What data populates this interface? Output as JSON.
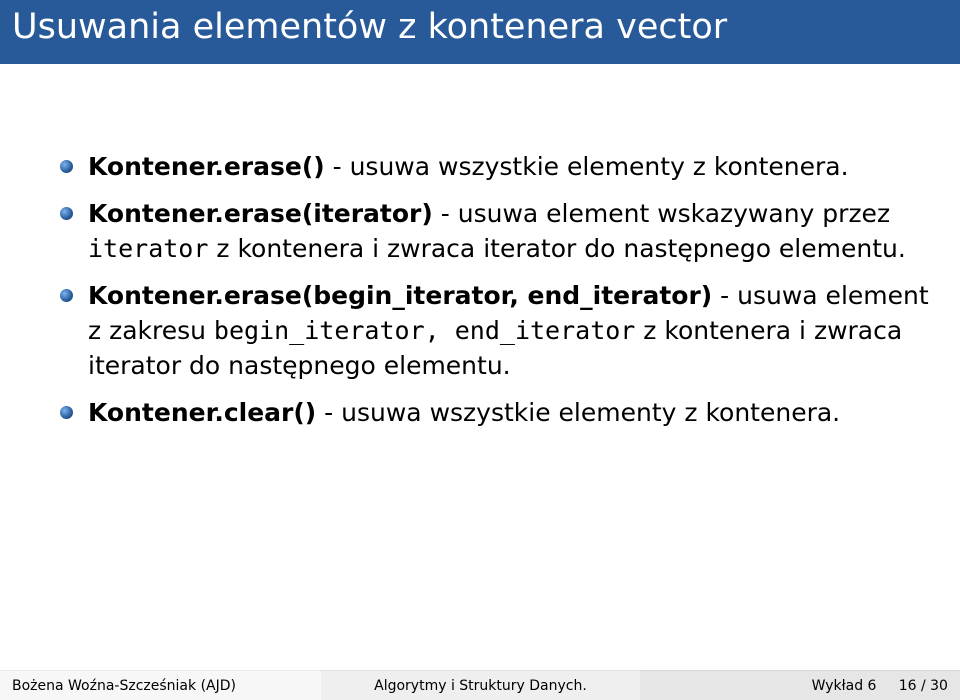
{
  "title": "Usuwania elementów z kontenera vector",
  "bullets": [
    {
      "method": "Kontener.erase()",
      "desc_before": " - usuwa wszystkie elementy z kontenera.",
      "code1": "",
      "mid": "",
      "code2": "",
      "desc_after": ""
    },
    {
      "method": "Kontener.erase(iterator)",
      "desc_before": " - usuwa element wskazywany przez ",
      "code1": "iterator",
      "mid": " z kontenera i zwraca iterator do następnego elementu.",
      "code2": "",
      "desc_after": ""
    },
    {
      "method": "Kontener.erase(begin_iterator, end_iterator)",
      "desc_before": " - usuwa element z zakresu ",
      "code1": "begin_iterator, end_iterator",
      "mid": " z kontenera i zwraca iterator do następnego elementu.",
      "code2": "",
      "desc_after": ""
    },
    {
      "method": "Kontener.clear()",
      "desc_before": " - usuwa wszystkie elementy z kontenera.",
      "code1": "",
      "mid": "",
      "code2": "",
      "desc_after": ""
    }
  ],
  "footer": {
    "author": "Bożena Woźna-Szcześniak (AJD)",
    "center": "Algorytmy i Struktury Danych.",
    "lecture": "Wykład 6",
    "page": "16 / 30"
  }
}
